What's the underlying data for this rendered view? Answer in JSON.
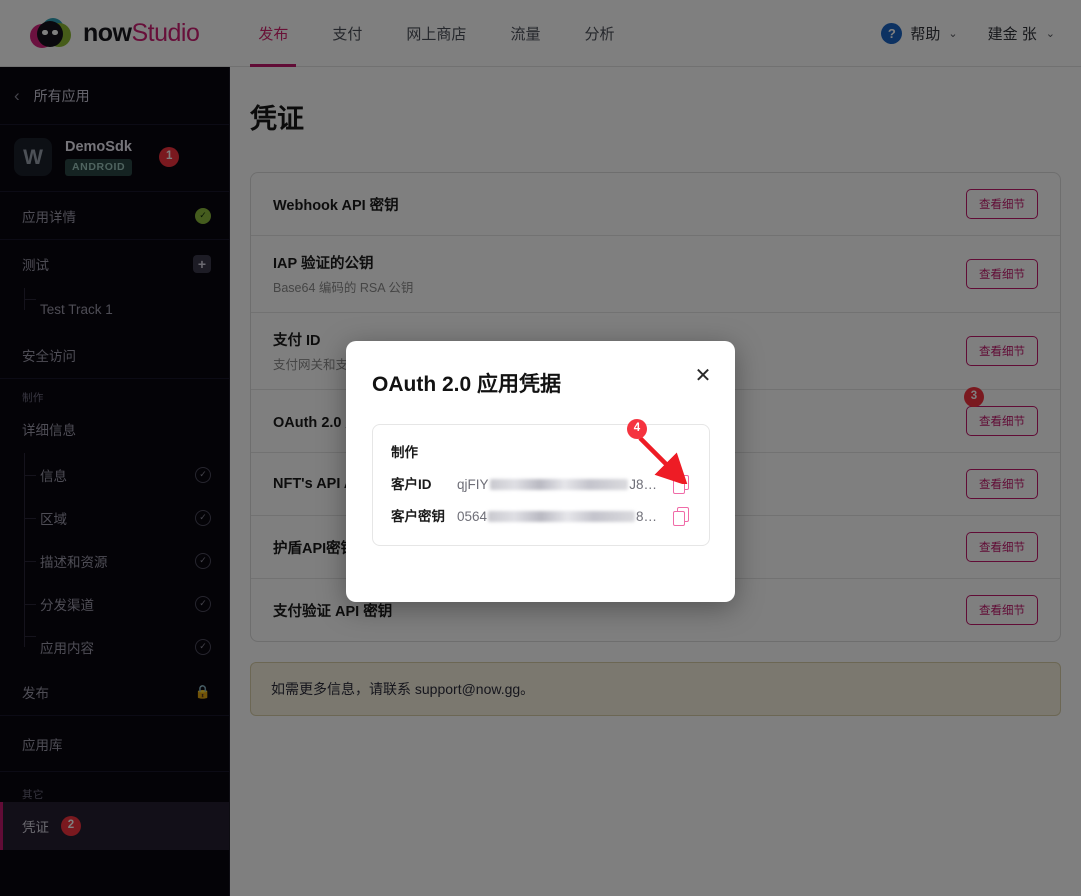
{
  "header": {
    "logo": {
      "now": "now",
      "studio": "Studio",
      "icon": "nowgg-logo-icon"
    },
    "nav": [
      {
        "label": "发布",
        "active": true
      },
      {
        "label": "支付",
        "active": false
      },
      {
        "label": "网上商店",
        "active": false
      },
      {
        "label": "流量",
        "active": false
      },
      {
        "label": "分析",
        "active": false
      }
    ],
    "help_label": "帮助",
    "help_icon_glyph": "?",
    "user_label": "建金 张",
    "chevron": "⌄"
  },
  "sidebar": {
    "back_label": "所有应用",
    "back_arrow": "‹",
    "app": {
      "icon_letter": "W",
      "name": "DemoSdk",
      "platform_badge": "ANDROID",
      "marker": "1"
    },
    "rows": [
      {
        "label": "应用详情",
        "status": "check-green"
      },
      {
        "label": "测试",
        "status": "plus"
      },
      {
        "label": "Test Track 1",
        "status": "none",
        "sub": true
      },
      {
        "label": "安全访问",
        "status": "none"
      }
    ],
    "section_build_label": "制作",
    "build_rows": [
      {
        "label": "详细信息",
        "status": "none"
      },
      {
        "label": "信息",
        "status": "check",
        "sub": true
      },
      {
        "label": "区域",
        "status": "check",
        "sub": true
      },
      {
        "label": "描述和资源",
        "status": "check",
        "sub": true
      },
      {
        "label": "分发渠道",
        "status": "check",
        "sub": true
      },
      {
        "label": "应用内容",
        "status": "check",
        "sub": true
      },
      {
        "label": "发布",
        "status": "lock"
      }
    ],
    "library_label": "应用库",
    "section_other_label": "其它",
    "credentials_label": "凭证",
    "credentials_marker": "2"
  },
  "main": {
    "page_title": "凭证",
    "view_details_label": "查看细节",
    "credentials": [
      {
        "name": "Webhook API 密钥",
        "desc": ""
      },
      {
        "name": "IAP 验证的公钥",
        "desc": "Base64 编码的 RSA 公钥"
      },
      {
        "name": "支付 ID",
        "desc": "支付网关和支付 ID"
      },
      {
        "name": "OAuth 2.0 应用凭据",
        "desc": "",
        "marker": "3"
      },
      {
        "name": "NFT's API Access Key",
        "desc": ""
      },
      {
        "name": "护盾API密钥",
        "desc": ""
      },
      {
        "name": "支付验证 API 密钥",
        "desc": ""
      }
    ],
    "note": "如需更多信息，请联系 support@now.gg。"
  },
  "modal": {
    "title": "OAuth 2.0 应用凭据",
    "close_glyph": "✕",
    "section_label": "制作",
    "fields": [
      {
        "key": "客户ID",
        "value_prefix": "qjFIY",
        "value_suffix": "J8…",
        "copy_icon": "copy-icon"
      },
      {
        "key": "客户密钥",
        "value_prefix": "0564",
        "value_suffix": "8…",
        "copy_icon": "copy-icon"
      }
    ],
    "marker": "4"
  },
  "colors": {
    "accent_pink": "#c2186c",
    "badge_red": "#f5333f",
    "sidebar_bg": "#09060f",
    "overlay": "rgba(0,0,0,0.5)",
    "check_green": "#8ab83c",
    "copy_icon_pink": "#f06ba8"
  }
}
